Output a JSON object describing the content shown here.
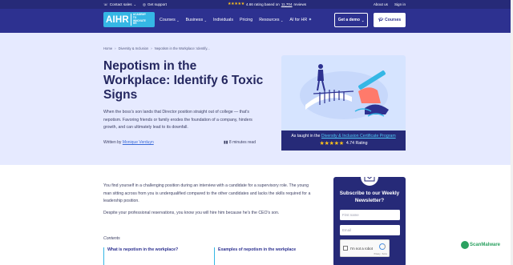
{
  "topbar": {
    "contact_sales": "Contact sales",
    "get_support": "Get support",
    "rating_text": "4.66 rating based on",
    "reviews_count": "11,704",
    "reviews_suffix": "reviews",
    "about_us": "About us",
    "sign_in": "Sign in"
  },
  "nav": {
    "logo_main": "AIHR",
    "logo_sub": "ACADEMY TO INNOVATE HR",
    "menu": [
      "Courses",
      "Business",
      "Individuals",
      "Pricing",
      "Resources",
      "AI for HR"
    ],
    "get_demo": "Get a demo",
    "courses_btn": "Courses"
  },
  "breadcrumb": [
    "Home",
    "Diversity & Inclusion",
    "Nepotism in the Workplace: Identify..."
  ],
  "article": {
    "title": "Nepotism in the Workplace: Identify 6 Toxic Signs",
    "intro": "When the boss's son lands that Director position straight out of college — that's nepotism. Favoring friends or family erodes the foundation of a company, hinders growth, and can ultimately lead to its downfall.",
    "written_by": "Written by",
    "author": "Monique Verduyn",
    "read_time": "8 minutes read",
    "p1": "You find yourself in a challenging position during an interview with a candidate for a supervisory role. The young man sitting across from you is underqualified compared to the other candidates and lacks the skills required for a leadership position.",
    "p2": "Despite your professional reservations, you know you will hire him because he's the CEO's son.",
    "contents_label": "Contents",
    "toc": [
      "What is nepotism in the workplace?",
      "Examples of nepotism in the workplace"
    ]
  },
  "certificate": {
    "prefix": "As taught in the",
    "link": "Diversity & Inclusion Certificate Program",
    "rating": "4.74 Rating"
  },
  "newsletter": {
    "heading": "Subscribe to our Weekly Newsletter?",
    "first_name_placeholder": "First name",
    "email_placeholder": "Email",
    "captcha_label": "I'm not a robot",
    "captcha_footer": "Privacy - Terms"
  },
  "watermark": "ScanMalware",
  "colors": {
    "topbar": "#262a78",
    "nav": "#2d3190",
    "accent": "#35b7e5",
    "hero_bg": "#e6eaff",
    "star": "#ffc21b"
  }
}
